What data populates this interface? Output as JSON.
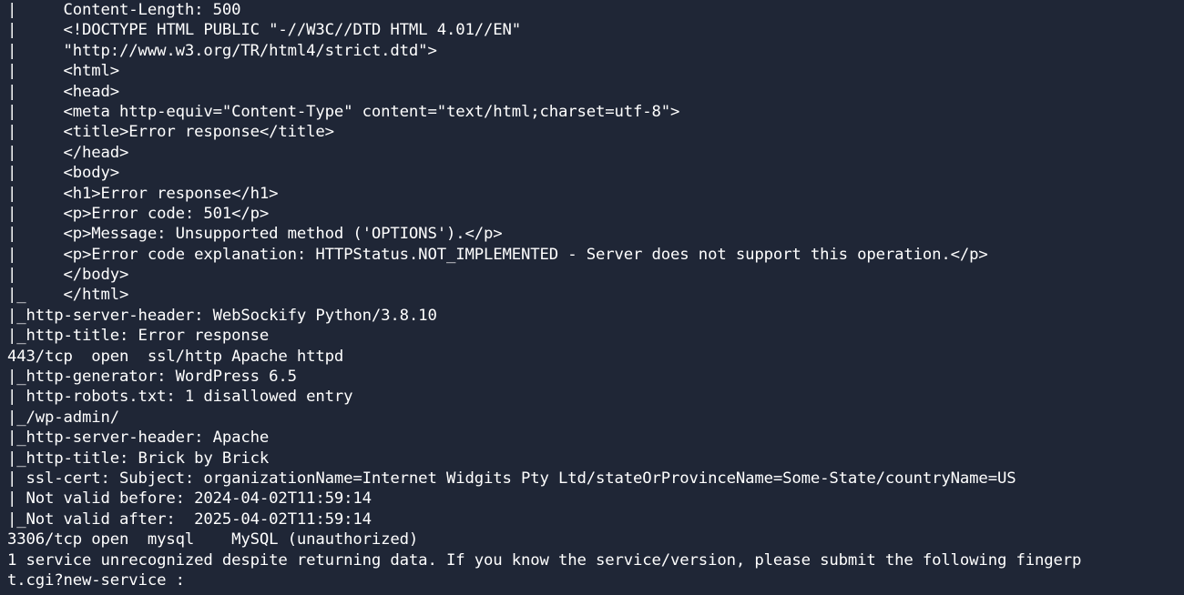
{
  "terminal": {
    "lines": [
      "|     Content-Length: 500",
      "|     <!DOCTYPE HTML PUBLIC \"-//W3C//DTD HTML 4.01//EN\"",
      "|     \"http://www.w3.org/TR/html4/strict.dtd\">",
      "|     <html>",
      "|     <head>",
      "|     <meta http-equiv=\"Content-Type\" content=\"text/html;charset=utf-8\">",
      "|     <title>Error response</title>",
      "|     </head>",
      "|     <body>",
      "|     <h1>Error response</h1>",
      "|     <p>Error code: 501</p>",
      "|     <p>Message: Unsupported method ('OPTIONS').</p>",
      "|     <p>Error code explanation: HTTPStatus.NOT_IMPLEMENTED - Server does not support this operation.</p>",
      "|     </body>",
      "|_    </html>",
      "|_http-server-header: WebSockify Python/3.8.10",
      "|_http-title: Error response",
      "443/tcp  open  ssl/http Apache httpd",
      "|_http-generator: WordPress 6.5",
      "| http-robots.txt: 1 disallowed entry",
      "|_/wp-admin/",
      "|_http-server-header: Apache",
      "|_http-title: Brick by Brick",
      "| ssl-cert: Subject: organizationName=Internet Widgits Pty Ltd/stateOrProvinceName=Some-State/countryName=US",
      "| Not valid before: 2024-04-02T11:59:14",
      "|_Not valid after:  2025-04-02T11:59:14",
      "3306/tcp open  mysql    MySQL (unauthorized)",
      "1 service unrecognized despite returning data. If you know the service/version, please submit the following fingerp",
      "t.cgi?new-service :"
    ]
  }
}
